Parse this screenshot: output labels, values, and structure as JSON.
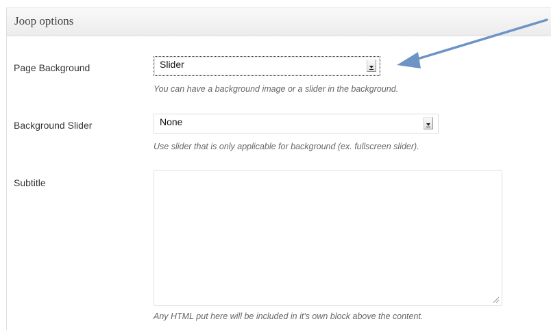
{
  "metabox": {
    "title": "Joop options"
  },
  "fields": {
    "page_background": {
      "label": "Page Background",
      "selected": "Slider",
      "help": "You can have a background image or a slider in the background."
    },
    "background_slider": {
      "label": "Background Slider",
      "selected": "None",
      "help": "Use slider that is only applicable for background (ex. fullscreen slider)."
    },
    "subtitle": {
      "label": "Subtitle",
      "value": "",
      "help": "Any HTML put here will be included in it's own block above the content."
    }
  },
  "annotation": {
    "arrow_color": "#6d94c4"
  },
  "icons": {
    "select_arrow": "chevron-down-icon",
    "resize": "resize-grip-icon",
    "pointer": "annotation-arrow-icon"
  }
}
